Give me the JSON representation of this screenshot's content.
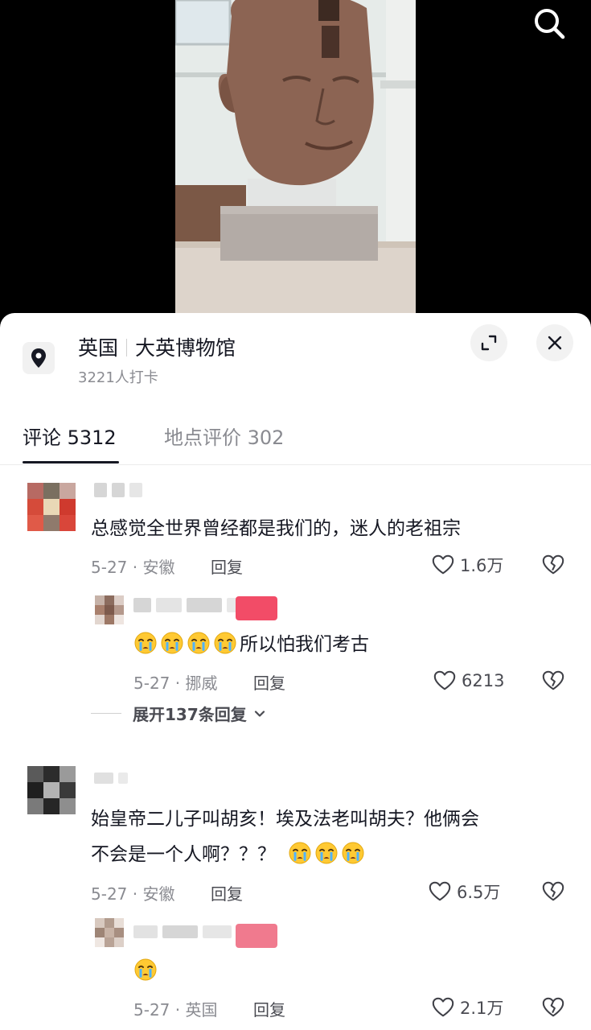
{
  "location": {
    "country": "英国",
    "place": "大英博物馆",
    "checkins": "3221人打卡"
  },
  "tabs": [
    {
      "label": "评论 5312"
    },
    {
      "label": "地点评价 302"
    }
  ],
  "comments": [
    {
      "text": "总感觉全世界曾经都是我们的，迷人的老祖宗",
      "meta": "5-27 · 安徽",
      "reply_label": "回复",
      "likes": "1.6万"
    },
    {
      "text_suffix": "所以怕我们考古",
      "meta": "5-27 · 挪威",
      "reply_label": "回复",
      "likes": "6213"
    },
    {
      "line1": "始皇帝二儿子叫胡亥！埃及法老叫胡夫？他俩会",
      "line2": "不会是一个人啊？？？",
      "meta": "5-27 · 安徽",
      "reply_label": "回复",
      "likes": "6.5万"
    },
    {
      "meta": "5-27 · 英国",
      "reply_label": "回复",
      "likes": "2.1万"
    }
  ],
  "expand_replies": "展开137条回复",
  "icons": {
    "search": "search-icon",
    "location": "location-pin-icon",
    "expand": "expand-icon",
    "close": "close-icon",
    "like": "heart-icon",
    "dislike": "broken-heart-icon",
    "emoji": "crying-face-emoji"
  },
  "colors": {
    "badge": "#f24c67",
    "text": "#161823",
    "muted": "#8a8b91"
  }
}
